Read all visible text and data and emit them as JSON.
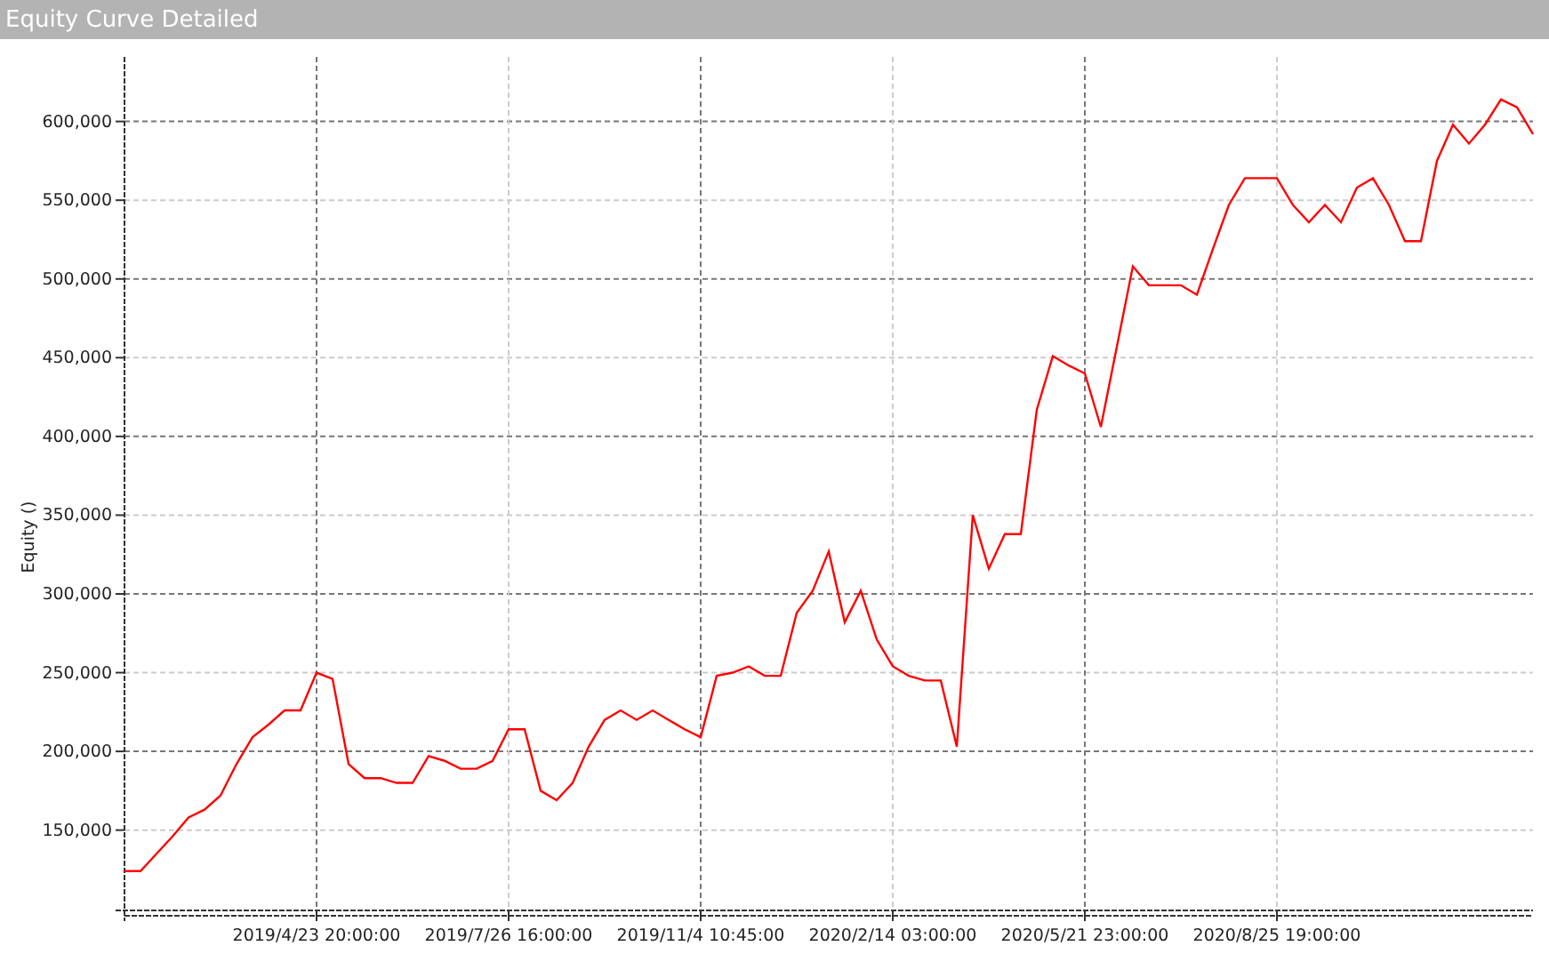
{
  "window": {
    "title": "Equity Curve Detailed"
  },
  "chart": {
    "chart_data": {
      "type": "line",
      "ylabel": "Equity ()",
      "categories": [
        null,
        null,
        null,
        null,
        null,
        null,
        null,
        null,
        null,
        null,
        null,
        null,
        "2019/4/23 20:00:00",
        null,
        null,
        null,
        null,
        null,
        null,
        null,
        null,
        null,
        null,
        null,
        "2019/7/26 16:00:00",
        null,
        null,
        null,
        null,
        null,
        null,
        null,
        null,
        null,
        null,
        null,
        "2019/11/4 10:45:00",
        null,
        null,
        null,
        null,
        null,
        null,
        null,
        null,
        null,
        null,
        null,
        "2020/2/14 03:00:00",
        null,
        null,
        null,
        null,
        null,
        null,
        null,
        null,
        null,
        null,
        null,
        "2020/5/21 23:00:00",
        null,
        null,
        null,
        null,
        null,
        null,
        null,
        null,
        null,
        null,
        null,
        "2020/8/25 19:00:00",
        null,
        null,
        null,
        null,
        null,
        null,
        null,
        null,
        null,
        null,
        null,
        null,
        null,
        null,
        null,
        null
      ],
      "series": [
        {
          "color": "#ff0000",
          "values": [
            124000,
            124000,
            135000,
            146000,
            158000,
            163000,
            172000,
            192000,
            209000,
            217000,
            226000,
            226000,
            250000,
            246000,
            192000,
            183000,
            183000,
            180000,
            180000,
            197000,
            194000,
            189000,
            189000,
            194000,
            214000,
            214000,
            175000,
            169000,
            180000,
            203000,
            220000,
            226000,
            220000,
            226000,
            220000,
            214000,
            209000,
            248000,
            250000,
            254000,
            248000,
            248000,
            288000,
            302000,
            327000,
            282000,
            302000,
            271000,
            254000,
            248000,
            245000,
            245000,
            203000,
            350000,
            316000,
            338000,
            338000,
            417000,
            451000,
            445000,
            440000,
            406000,
            457000,
            508000,
            496000,
            496000,
            496000,
            490000,
            519000,
            547000,
            564000,
            564000,
            564000,
            547000,
            536000,
            547000,
            536000,
            558000,
            564000,
            547000,
            524000,
            524000,
            575000,
            598000,
            586000,
            598000,
            614000,
            609000,
            592000
          ]
        }
      ],
      "ylim": [
        99000,
        641000
      ],
      "grid": true,
      "yticks": [
        {
          "value": 150000,
          "label": "150,000"
        },
        {
          "value": 200000,
          "label": "200,000"
        },
        {
          "value": 250000,
          "label": "250,000"
        },
        {
          "value": 300000,
          "label": "300,000"
        },
        {
          "value": 350000,
          "label": "350,000"
        },
        {
          "value": 400000,
          "label": "400,000"
        },
        {
          "value": 450000,
          "label": "450,000"
        },
        {
          "value": 500000,
          "label": "500,000"
        },
        {
          "value": 550000,
          "label": "550,000"
        },
        {
          "value": 600000,
          "label": "600,000"
        }
      ]
    }
  }
}
